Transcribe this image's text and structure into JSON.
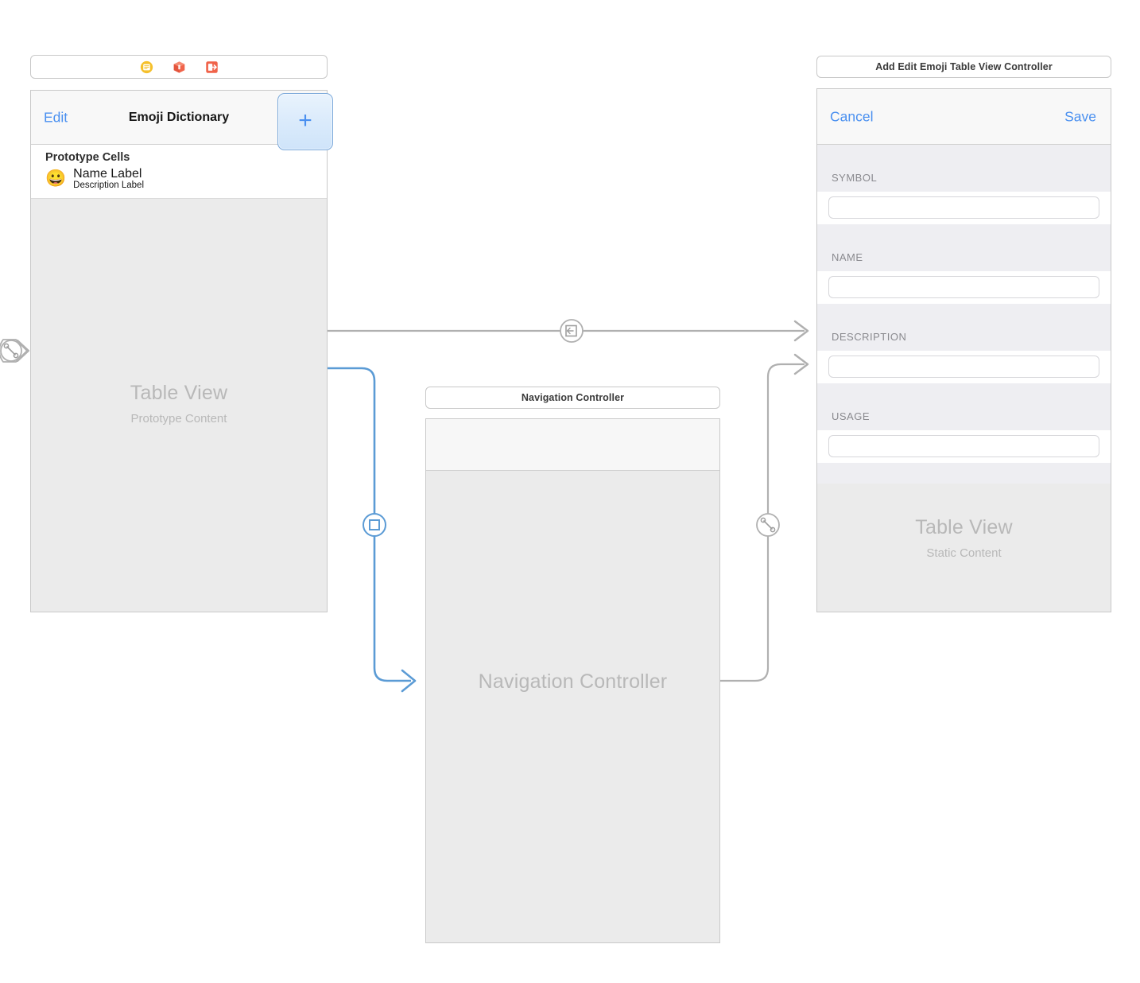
{
  "scenes": {
    "emoji_dictionary": {
      "bar_icons": [
        "view-controller-icon",
        "first-responder-icon",
        "exit-icon"
      ],
      "navbar": {
        "left_button": "Edit",
        "title": "Emoji Dictionary",
        "right_button": "+"
      },
      "prototype_cells_header": "Prototype Cells",
      "cell": {
        "emoji": "😀",
        "name_label": "Name Label",
        "description_label": "Description Label"
      },
      "placeholder": {
        "title": "Table View",
        "subtitle": "Prototype Content"
      }
    },
    "navigation_controller": {
      "bar_title": "Navigation Controller",
      "placeholder": {
        "title": "Navigation Controller"
      }
    },
    "add_edit_emoji": {
      "bar_title": "Add Edit Emoji Table View Controller",
      "navbar": {
        "left_button": "Cancel",
        "right_button": "Save"
      },
      "form_sections": [
        {
          "label": "SYMBOL",
          "value": "",
          "placeholder": ""
        },
        {
          "label": "NAME",
          "value": "",
          "placeholder": ""
        },
        {
          "label": "DESCRIPTION",
          "value": "",
          "placeholder": ""
        },
        {
          "label": "USAGE",
          "value": "",
          "placeholder": ""
        }
      ],
      "placeholder": {
        "title": "Table View",
        "subtitle": "Static Content"
      }
    }
  },
  "connections": [
    {
      "name": "entry-point-arrow",
      "kind": "storyboard-entry-point",
      "color": "#b0b0b0"
    },
    {
      "name": "show-detail-segue",
      "kind": "present-modally",
      "color": "#b0b0b0"
    },
    {
      "name": "relationship-segue-root",
      "kind": "relationship-root-view-controller",
      "color": "#5b9bd5"
    },
    {
      "name": "relationship-segue-nav",
      "kind": "relationship-root-view-controller",
      "color": "#b0b0b0"
    }
  ],
  "colors": {
    "accent_blue": "#4a90f0",
    "wire_gray": "#b0b0b0",
    "wire_blue": "#5b9bd5",
    "panel_fill": "#ebebeb",
    "form_fill": "#eeeef2",
    "icon_yellow": "#f5c02c",
    "icon_orange": "#f0634a"
  }
}
